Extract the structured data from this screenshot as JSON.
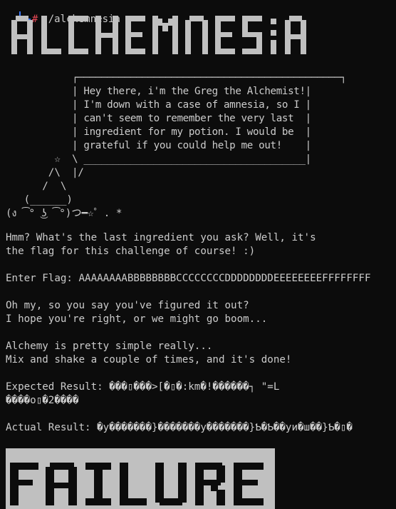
{
  "prompt": {
    "hash": "#",
    "command": "./alchemnesia"
  },
  "banner_title": "ALCHEMNESIA",
  "speech_bubble": [
    "┌─────────────────────────────────────────────┐",
    "| Hey there, i'm the Greg the Alchemist!|",
    "| I'm down with a case of amnesia, so I |",
    "| can't seem to remember the very last  |",
    "| ingredient for my potion. I would be  |",
    "| grateful if you could help me out!    |",
    "\\ ______________________________________|",
    "|/"
  ],
  "wizard_art": [
    "        ☆",
    "       /\\",
    "      /  \\",
    "   (______)",
    "(ง ͡° ͜ʖ ͡°)つ━☆゜. *"
  ],
  "dialogue": {
    "intro_line1": "Hmm? What's the last ingredient you ask? Well, it's",
    "intro_line2": "the flag for this challenge of course! :)",
    "flag_label": "Enter Flag: ",
    "flag_input": "AAAAAAAABBBBBBBBCCCCCCCCDDDDDDDDEEEEEEEEFFFFFFFF",
    "response_line1": "Oh my, so you say you've figured it out?",
    "response_line2": "I hope you're right, or we might go boom...",
    "process_line1": "Alchemy is pretty simple really...",
    "process_line2": "Mix and shake a couple of times, and it's done!",
    "expected_label": "Expected Result: ",
    "expected_value_line1": "���▯���>[�▯�:km�!������┐ \"=L",
    "expected_value_line2": "����o▯�2����",
    "actual_label": "Actual Result: ",
    "actual_value": "�y�������}�������y�������}Ƅ�Ƅ��yи�ш��}Ƅ�▯�"
  },
  "result_banner": "FAILURE",
  "colors": {
    "background": "#0c0c0c",
    "text": "#cccccc",
    "prompt_line": "#3b78ff",
    "prompt_hash": "#e74856",
    "banner_text": "#c0c0c0",
    "failure_background": "#c0c0c0",
    "failure_text": "#0c0c0c"
  }
}
